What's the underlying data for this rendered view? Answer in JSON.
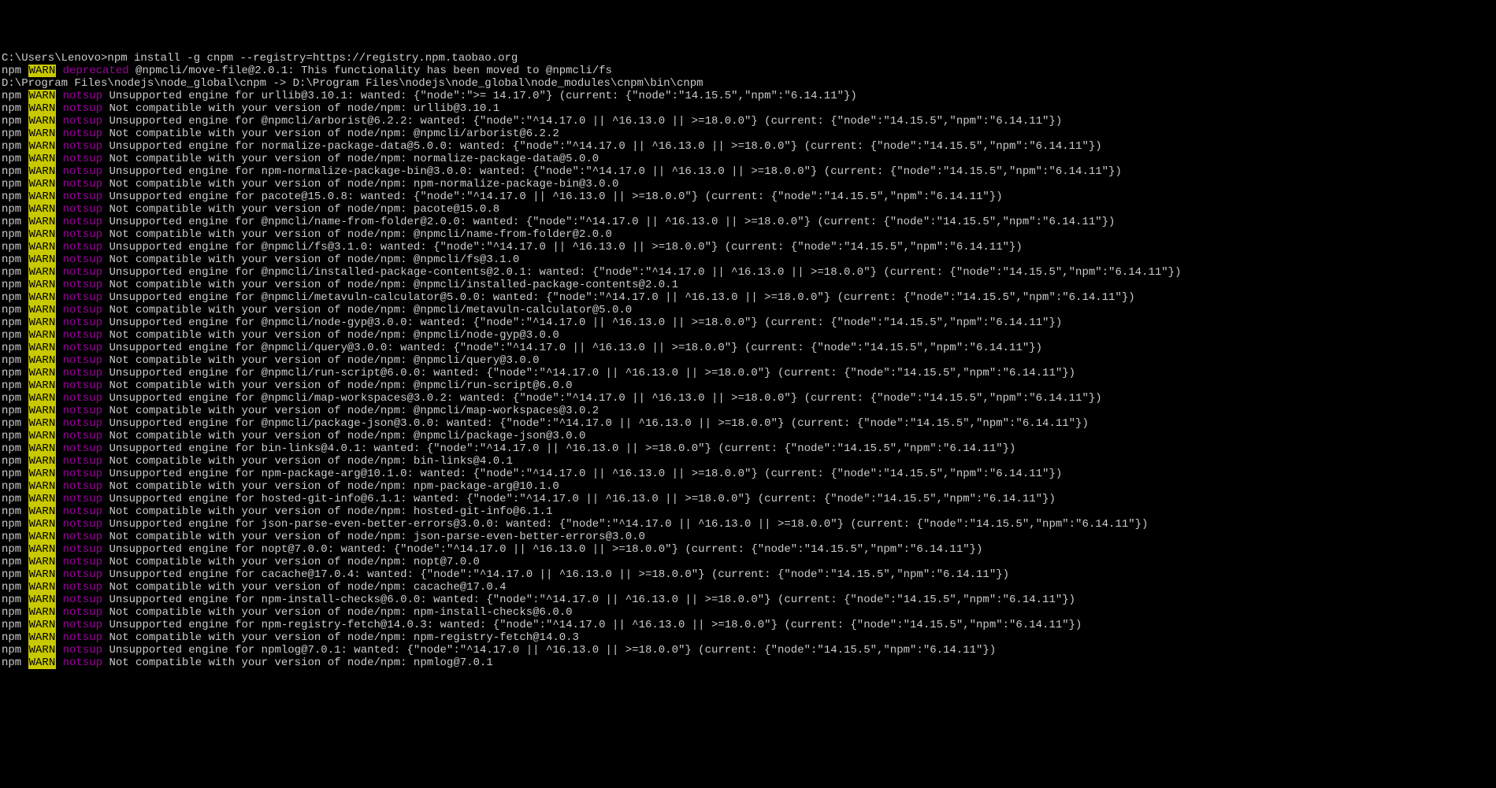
{
  "colors": {
    "warn_bg": "#c9c900",
    "warn_fg": "#000000",
    "keyword": "#a000a0",
    "text": "#cccccc",
    "bg": "#000000"
  },
  "prompt": "C:\\Users\\Lenovo>",
  "command": "npm install -g cnpm --registry=https://registry.npm.taobao.org",
  "dep_line": "@npmcli/move-file@2.0.1: This functionality has been moved to @npmcli/fs",
  "link_line": "D:\\Program Files\\nodejs\\node_global\\cnpm -> D:\\Program Files\\nodejs\\node_global\\node_modules\\cnpm\\bin\\cnpm",
  "warn_label": "WARN",
  "npm_label": "npm",
  "deprecated_label": "deprecated",
  "notsup_label": "notsup",
  "lines": [
    "Unsupported engine for urllib@3.10.1: wanted: {\"node\":\">= 14.17.0\"} (current: {\"node\":\"14.15.5\",\"npm\":\"6.14.11\"})",
    "Not compatible with your version of node/npm: urllib@3.10.1",
    "Unsupported engine for @npmcli/arborist@6.2.2: wanted: {\"node\":\"^14.17.0 || ^16.13.0 || >=18.0.0\"} (current: {\"node\":\"14.15.5\",\"npm\":\"6.14.11\"})",
    "Not compatible with your version of node/npm: @npmcli/arborist@6.2.2",
    "Unsupported engine for normalize-package-data@5.0.0: wanted: {\"node\":\"^14.17.0 || ^16.13.0 || >=18.0.0\"} (current: {\"node\":\"14.15.5\",\"npm\":\"6.14.11\"})",
    "Not compatible with your version of node/npm: normalize-package-data@5.0.0",
    "Unsupported engine for npm-normalize-package-bin@3.0.0: wanted: {\"node\":\"^14.17.0 || ^16.13.0 || >=18.0.0\"} (current: {\"node\":\"14.15.5\",\"npm\":\"6.14.11\"})",
    "Not compatible with your version of node/npm: npm-normalize-package-bin@3.0.0",
    "Unsupported engine for pacote@15.0.8: wanted: {\"node\":\"^14.17.0 || ^16.13.0 || >=18.0.0\"} (current: {\"node\":\"14.15.5\",\"npm\":\"6.14.11\"})",
    "Not compatible with your version of node/npm: pacote@15.0.8",
    "Unsupported engine for @npmcli/name-from-folder@2.0.0: wanted: {\"node\":\"^14.17.0 || ^16.13.0 || >=18.0.0\"} (current: {\"node\":\"14.15.5\",\"npm\":\"6.14.11\"})",
    "Not compatible with your version of node/npm: @npmcli/name-from-folder@2.0.0",
    "Unsupported engine for @npmcli/fs@3.1.0: wanted: {\"node\":\"^14.17.0 || ^16.13.0 || >=18.0.0\"} (current: {\"node\":\"14.15.5\",\"npm\":\"6.14.11\"})",
    "Not compatible with your version of node/npm: @npmcli/fs@3.1.0",
    "Unsupported engine for @npmcli/installed-package-contents@2.0.1: wanted: {\"node\":\"^14.17.0 || ^16.13.0 || >=18.0.0\"} (current: {\"node\":\"14.15.5\",\"npm\":\"6.14.11\"})",
    "Not compatible with your version of node/npm: @npmcli/installed-package-contents@2.0.1",
    "Unsupported engine for @npmcli/metavuln-calculator@5.0.0: wanted: {\"node\":\"^14.17.0 || ^16.13.0 || >=18.0.0\"} (current: {\"node\":\"14.15.5\",\"npm\":\"6.14.11\"})",
    "Not compatible with your version of node/npm: @npmcli/metavuln-calculator@5.0.0",
    "Unsupported engine for @npmcli/node-gyp@3.0.0: wanted: {\"node\":\"^14.17.0 || ^16.13.0 || >=18.0.0\"} (current: {\"node\":\"14.15.5\",\"npm\":\"6.14.11\"})",
    "Not compatible with your version of node/npm: @npmcli/node-gyp@3.0.0",
    "Unsupported engine for @npmcli/query@3.0.0: wanted: {\"node\":\"^14.17.0 || ^16.13.0 || >=18.0.0\"} (current: {\"node\":\"14.15.5\",\"npm\":\"6.14.11\"})",
    "Not compatible with your version of node/npm: @npmcli/query@3.0.0",
    "Unsupported engine for @npmcli/run-script@6.0.0: wanted: {\"node\":\"^14.17.0 || ^16.13.0 || >=18.0.0\"} (current: {\"node\":\"14.15.5\",\"npm\":\"6.14.11\"})",
    "Not compatible with your version of node/npm: @npmcli/run-script@6.0.0",
    "Unsupported engine for @npmcli/map-workspaces@3.0.2: wanted: {\"node\":\"^14.17.0 || ^16.13.0 || >=18.0.0\"} (current: {\"node\":\"14.15.5\",\"npm\":\"6.14.11\"})",
    "Not compatible with your version of node/npm: @npmcli/map-workspaces@3.0.2",
    "Unsupported engine for @npmcli/package-json@3.0.0: wanted: {\"node\":\"^14.17.0 || ^16.13.0 || >=18.0.0\"} (current: {\"node\":\"14.15.5\",\"npm\":\"6.14.11\"})",
    "Not compatible with your version of node/npm: @npmcli/package-json@3.0.0",
    "Unsupported engine for bin-links@4.0.1: wanted: {\"node\":\"^14.17.0 || ^16.13.0 || >=18.0.0\"} (current: {\"node\":\"14.15.5\",\"npm\":\"6.14.11\"})",
    "Not compatible with your version of node/npm: bin-links@4.0.1",
    "Unsupported engine for npm-package-arg@10.1.0: wanted: {\"node\":\"^14.17.0 || ^16.13.0 || >=18.0.0\"} (current: {\"node\":\"14.15.5\",\"npm\":\"6.14.11\"})",
    "Not compatible with your version of node/npm: npm-package-arg@10.1.0",
    "Unsupported engine for hosted-git-info@6.1.1: wanted: {\"node\":\"^14.17.0 || ^16.13.0 || >=18.0.0\"} (current: {\"node\":\"14.15.5\",\"npm\":\"6.14.11\"})",
    "Not compatible with your version of node/npm: hosted-git-info@6.1.1",
    "Unsupported engine for json-parse-even-better-errors@3.0.0: wanted: {\"node\":\"^14.17.0 || ^16.13.0 || >=18.0.0\"} (current: {\"node\":\"14.15.5\",\"npm\":\"6.14.11\"})",
    "Not compatible with your version of node/npm: json-parse-even-better-errors@3.0.0",
    "Unsupported engine for nopt@7.0.0: wanted: {\"node\":\"^14.17.0 || ^16.13.0 || >=18.0.0\"} (current: {\"node\":\"14.15.5\",\"npm\":\"6.14.11\"})",
    "Not compatible with your version of node/npm: nopt@7.0.0",
    "Unsupported engine for cacache@17.0.4: wanted: {\"node\":\"^14.17.0 || ^16.13.0 || >=18.0.0\"} (current: {\"node\":\"14.15.5\",\"npm\":\"6.14.11\"})",
    "Not compatible with your version of node/npm: cacache@17.0.4",
    "Unsupported engine for npm-install-checks@6.0.0: wanted: {\"node\":\"^14.17.0 || ^16.13.0 || >=18.0.0\"} (current: {\"node\":\"14.15.5\",\"npm\":\"6.14.11\"})",
    "Not compatible with your version of node/npm: npm-install-checks@6.0.0",
    "Unsupported engine for npm-registry-fetch@14.0.3: wanted: {\"node\":\"^14.17.0 || ^16.13.0 || >=18.0.0\"} (current: {\"node\":\"14.15.5\",\"npm\":\"6.14.11\"})",
    "Not compatible with your version of node/npm: npm-registry-fetch@14.0.3",
    "Unsupported engine for npmlog@7.0.1: wanted: {\"node\":\"^14.17.0 || ^16.13.0 || >=18.0.0\"} (current: {\"node\":\"14.15.5\",\"npm\":\"6.14.11\"})",
    "Not compatible with your version of node/npm: npmlog@7.0.1"
  ]
}
